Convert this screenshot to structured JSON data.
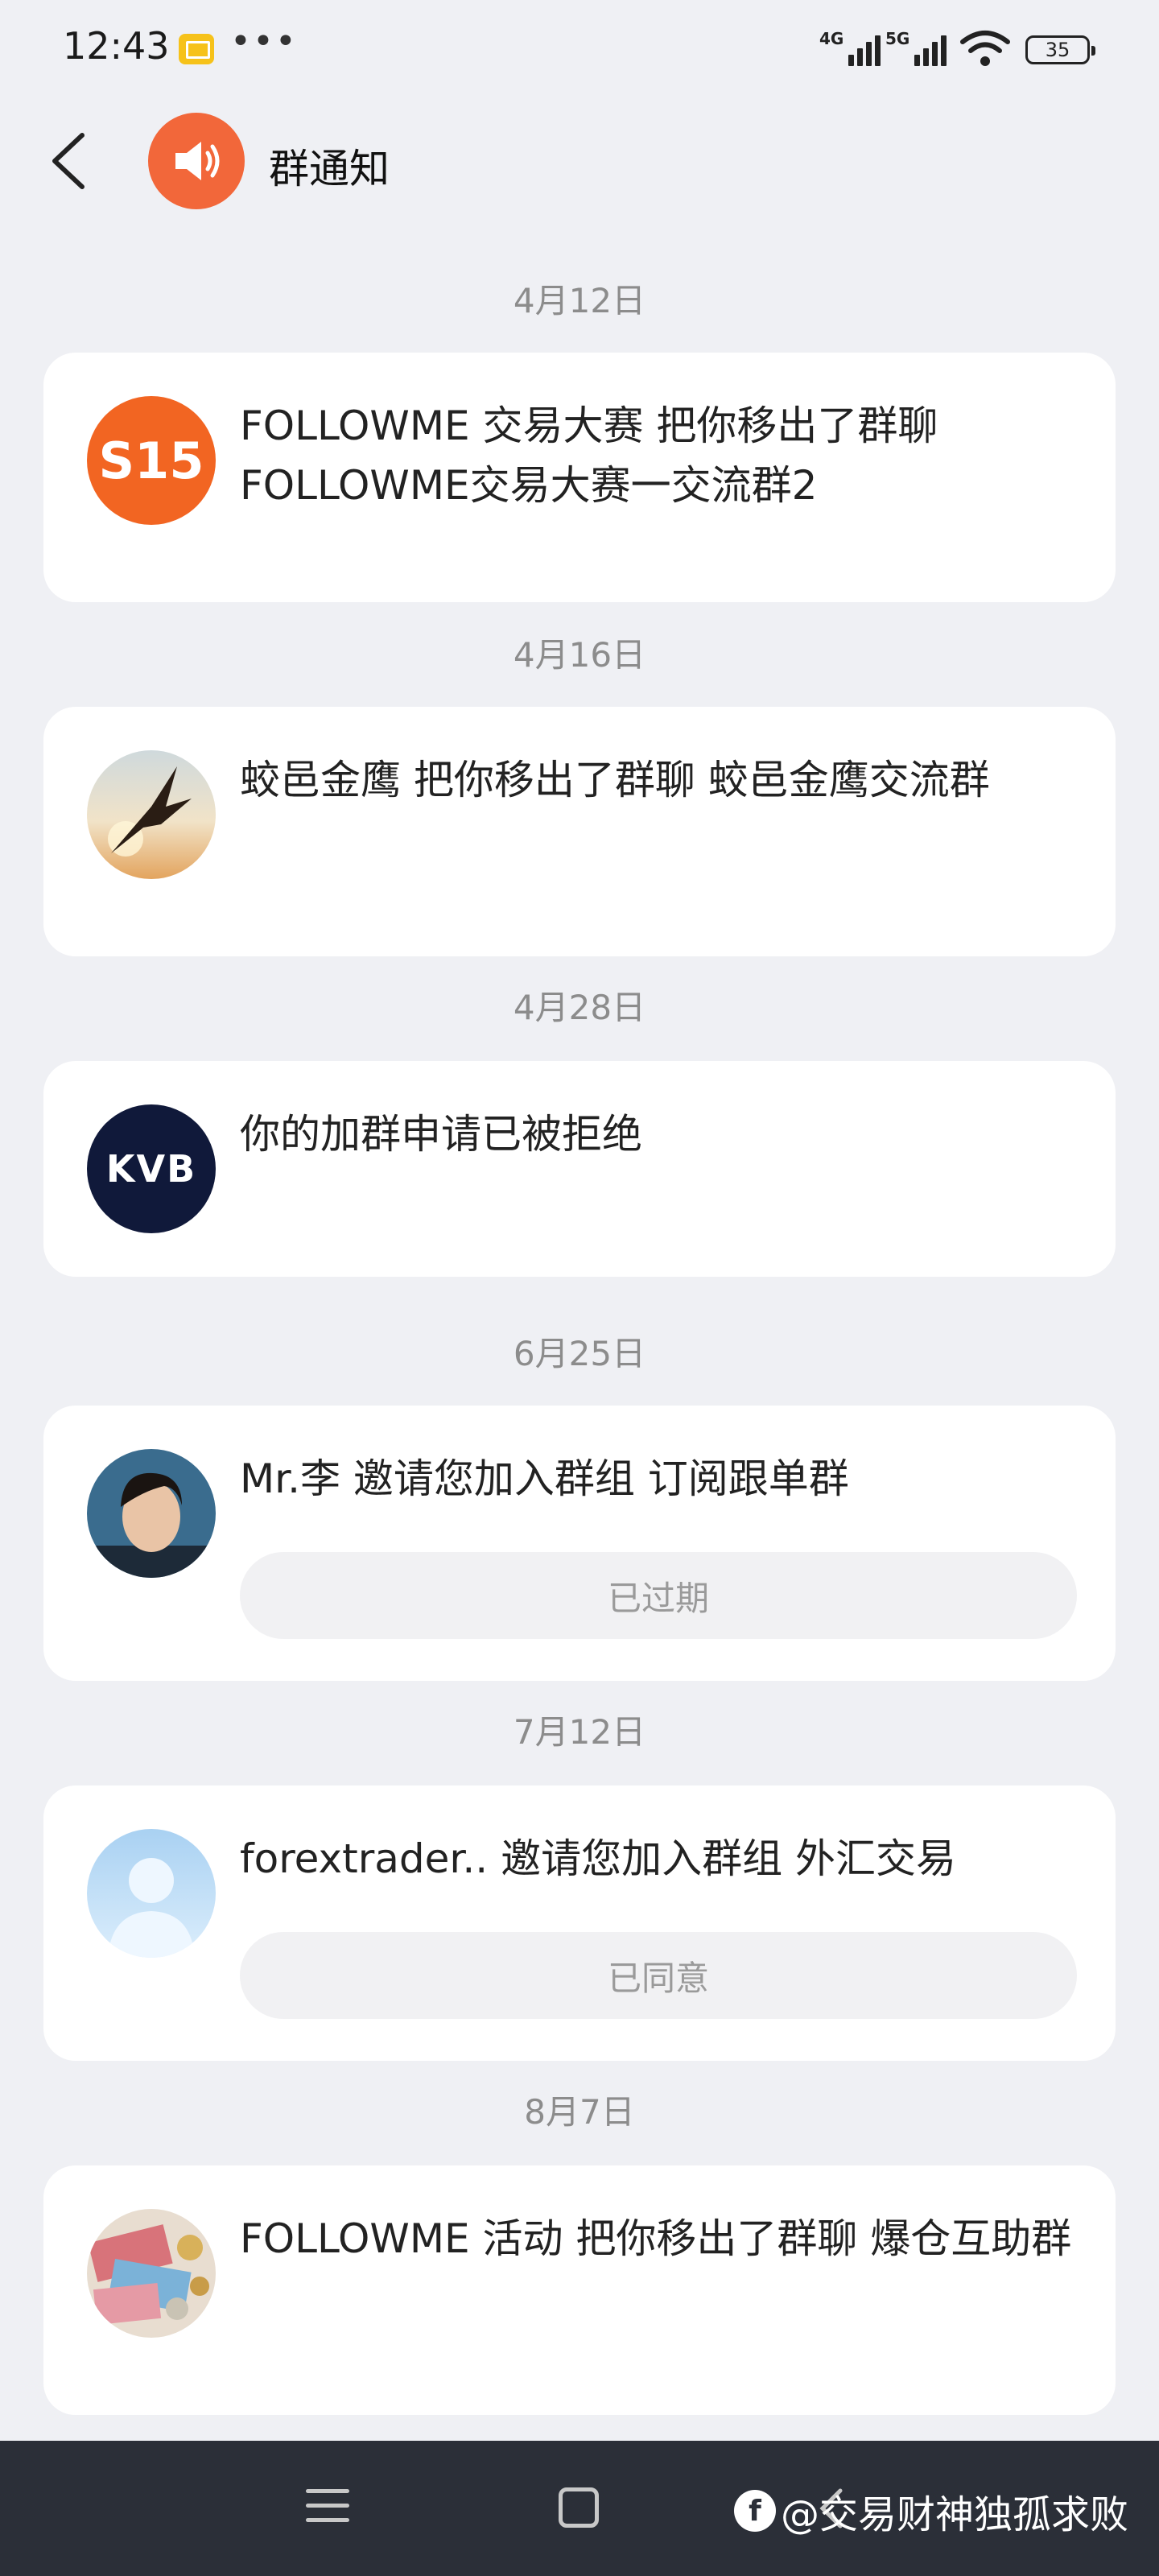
{
  "status_bar": {
    "time": "12:43",
    "dots": "•••",
    "net1": "4G",
    "net2": "5G",
    "battery": "35"
  },
  "header": {
    "title": "群通知"
  },
  "notifications": [
    {
      "date": "4月12日",
      "text": "FOLLOWME 交易大赛 把你移出了群聊 FOLLOWME交易大赛一交流群2",
      "avatar": "S15",
      "status": ""
    },
    {
      "date": "4月16日",
      "text": "蛟邑金鹰 把你移出了群聊 蛟邑金鹰交流群",
      "avatar": "",
      "status": ""
    },
    {
      "date": "4月28日",
      "text": "你的加群申请已被拒绝",
      "avatar": "KVB",
      "status": ""
    },
    {
      "date": "6月25日",
      "text": "Mr.李 邀请您加入群组 订阅跟单群",
      "avatar": "",
      "status": "已过期"
    },
    {
      "date": "7月12日",
      "text": "forextrader.. 邀请您加入群组 外汇交易",
      "avatar": "",
      "status": "已同意"
    },
    {
      "date": "8月7日",
      "text": "FOLLOWME 活动 把你移出了群聊 爆仓互助群",
      "avatar": "",
      "status": ""
    }
  ],
  "watermark": {
    "logo": "f",
    "text": "@交易财神独孤求败"
  },
  "colors": {
    "background": "#eff0f4",
    "card": "#ffffff",
    "accent_orange": "#f2673a",
    "kvb_navy": "#10193a",
    "nav_bar": "#2b2f38"
  }
}
